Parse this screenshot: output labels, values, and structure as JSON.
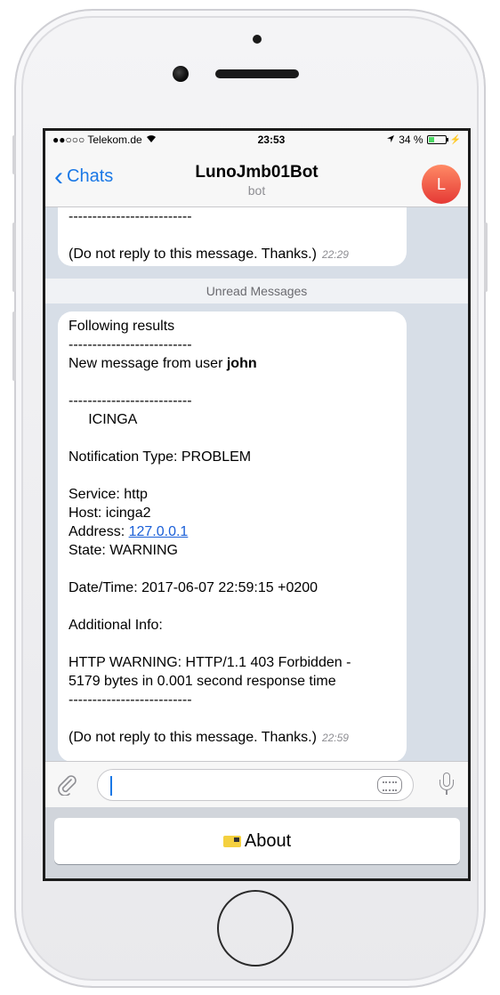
{
  "status_bar": {
    "carrier": "●●○○○ Telekom.de",
    "time": "23:53",
    "battery": "34 %",
    "battery_level": 0.34
  },
  "nav": {
    "back_label": "Chats",
    "title": "LunoJmb01Bot",
    "subtitle": "bot",
    "avatar_letter": "L"
  },
  "chat": {
    "prev_message": {
      "lines": [
        "--------------------------",
        "",
        "(Do not reply to this message. Thanks.)"
      ],
      "time": "22:29"
    },
    "unread_label": "Unread Messages",
    "message": {
      "line1": "Following results",
      "line2": "--------------------------",
      "line3_prefix": "New message from user ",
      "line3_user": "john",
      "line4": "",
      "line5": "--------------------------",
      "line6": "     ICINGA",
      "line7": "",
      "line8": "Notification Type: PROBLEM",
      "line9": "",
      "line10": "Service: http",
      "line11": "Host: icinga2",
      "line12_prefix": "Address: ",
      "line12_link": "127.0.0.1",
      "line13": "State: WARNING",
      "line14": "",
      "line15": "Date/Time: 2017-06-07 22:59:15 +0200",
      "line16": "",
      "line17": "Additional Info:",
      "line18": "",
      "line19": "HTTP WARNING: HTTP/1.1 403 Forbidden -",
      "line20": "5179 bytes in 0.001 second response time",
      "line21": "--------------------------",
      "line22": "",
      "line23": "(Do not reply to this message. Thanks.)",
      "time": "22:59"
    }
  },
  "input": {
    "placeholder": ""
  },
  "keyboard": {
    "about_label": "About"
  }
}
